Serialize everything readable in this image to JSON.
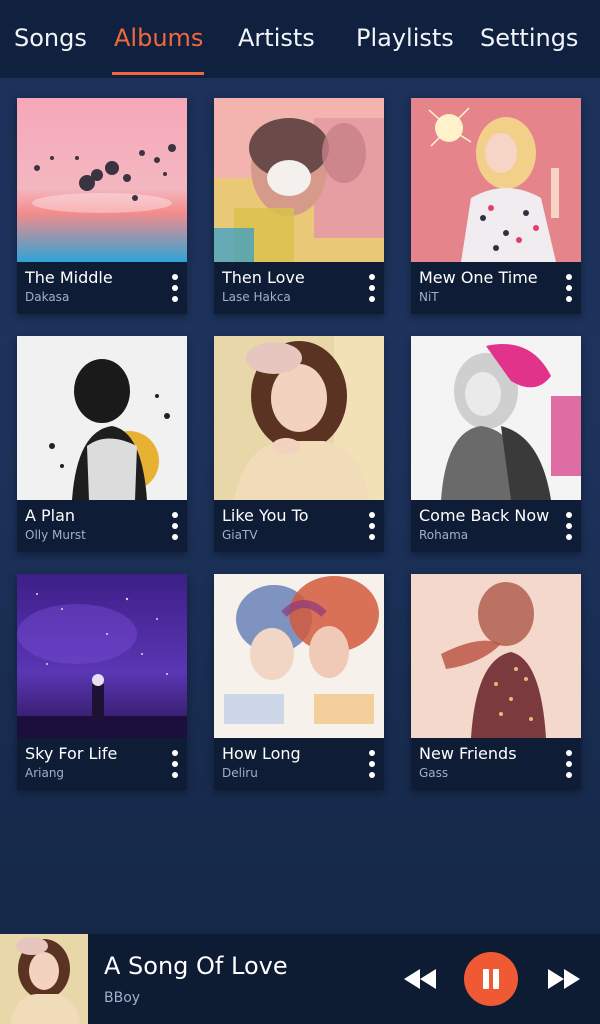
{
  "tabs": [
    {
      "label": "Songs"
    },
    {
      "label": "Albums"
    },
    {
      "label": "Artists"
    },
    {
      "label": "Playlists"
    },
    {
      "label": "Settings"
    }
  ],
  "active_tab": "Albums",
  "albums": [
    {
      "title": "The Middle",
      "artist": "Dakasa"
    },
    {
      "title": "Then Love",
      "artist": "Lase Hakca"
    },
    {
      "title": "Mew One Time",
      "artist": "NiT"
    },
    {
      "title": "A Plan",
      "artist": "Olly Murst"
    },
    {
      "title": "Like You To",
      "artist": "GiaTV"
    },
    {
      "title": "Come Back Now",
      "artist": "Rohama"
    },
    {
      "title": "Sky For Life",
      "artist": "Ariang"
    },
    {
      "title": "How Long",
      "artist": "Deliru"
    },
    {
      "title": "New Friends",
      "artist": "Gass"
    }
  ],
  "now_playing": {
    "title": "A Song Of Love",
    "artist": "BBoy"
  },
  "colors": {
    "accent": "#f1683d",
    "tab_bar": "#0f213f",
    "card_meta": "#0f1c35",
    "background": "#1c3159"
  },
  "icons": {
    "more": "more-vertical-icon",
    "prev": "rewind-icon",
    "pause": "pause-icon",
    "next": "fast-forward-icon"
  }
}
